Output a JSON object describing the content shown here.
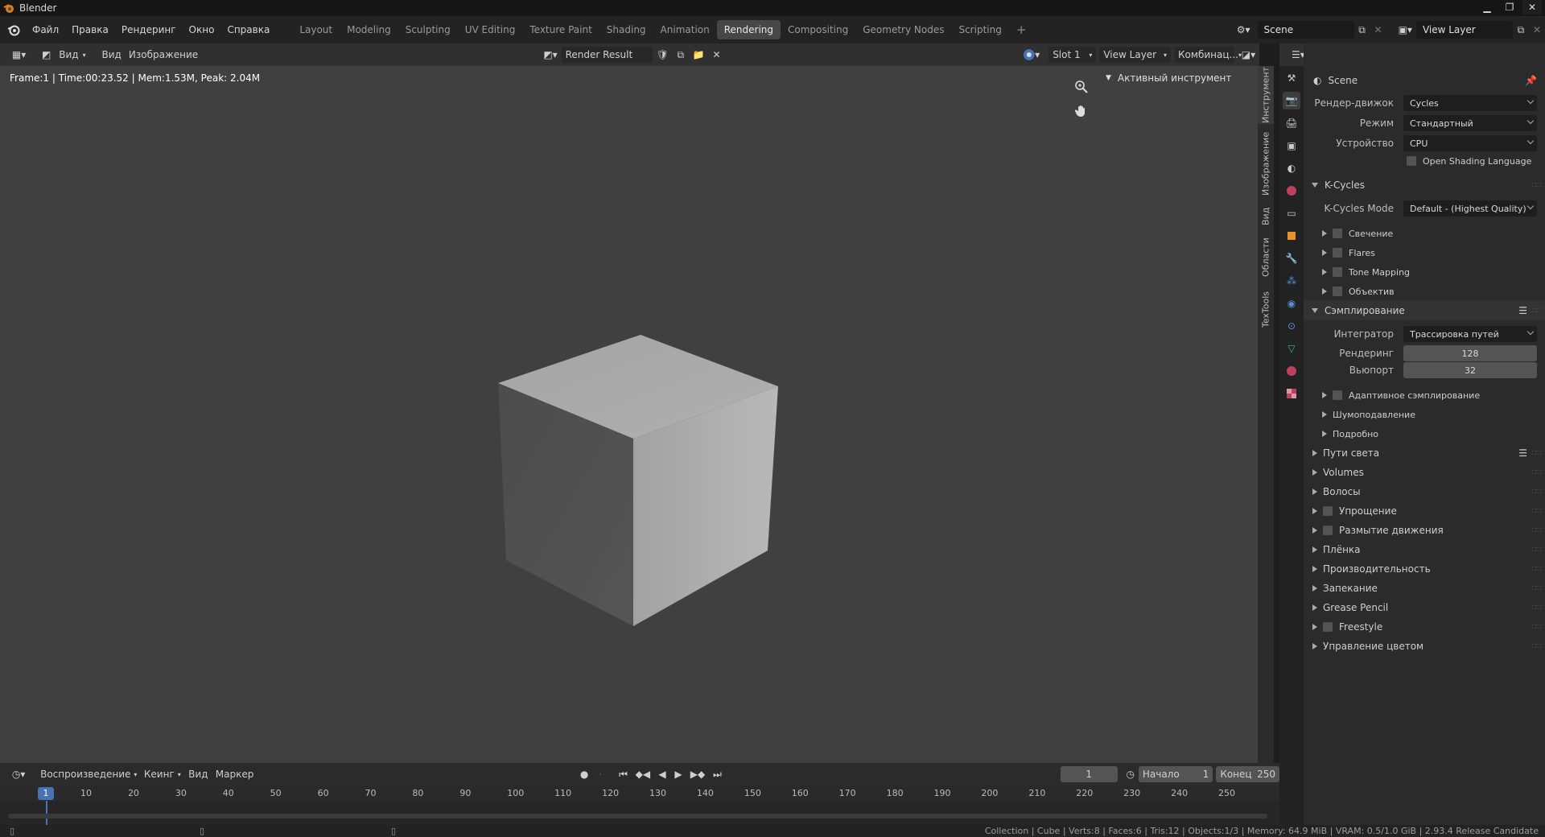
{
  "window": {
    "title": "Blender"
  },
  "menu": [
    "Файл",
    "Правка",
    "Рендеринг",
    "Окно",
    "Справка"
  ],
  "workspaces": [
    "Layout",
    "Modeling",
    "Sculpting",
    "UV Editing",
    "Texture Paint",
    "Shading",
    "Animation",
    "Rendering",
    "Compositing",
    "Geometry Nodes",
    "Scripting"
  ],
  "active_workspace": "Rendering",
  "scene": {
    "name": "Scene",
    "view_layer": "View Layer"
  },
  "image_header": {
    "view": "Вид",
    "view2": "Вид",
    "image": "Изображение",
    "image_name": "Render Result",
    "slot": "Slot 1",
    "view_layer": "View Layer",
    "pass": "Комбинац..."
  },
  "render_info": "Frame:1 | Time:00:23.52 | Mem:1.53M, Peak: 2.04M",
  "tool_panel": {
    "active_tool": "Активный инструмент"
  },
  "side_tabs": [
    "Инструмент",
    "Изображение",
    "Вид",
    "Области",
    "TexTools"
  ],
  "properties": {
    "context": "Scene",
    "render_engine_label": "Рендер-движок",
    "render_engine": "Cycles",
    "mode_label": "Режим",
    "mode": "Стандартный",
    "device_label": "Устройство",
    "device": "CPU",
    "osl": "Open Shading Language",
    "kcycles": {
      "title": "K-Cycles",
      "mode_label": "K-Cycles Mode",
      "mode": "Default - (Highest Quality)",
      "items": [
        "Свечение",
        "Flares",
        "Tone Mapping",
        "Объектив"
      ]
    },
    "sampling": {
      "title": "Сэмплирование",
      "integrator_label": "Интегратор",
      "integrator": "Трассировка путей",
      "render_label": "Рендеринг",
      "render": "128",
      "viewport_label": "Вьюпорт",
      "viewport": "32",
      "subs": [
        "Адаптивное сэмплирование",
        "Шумоподавление",
        "Подробно"
      ]
    },
    "sections": [
      {
        "label": "Пути света",
        "checkbox": false
      },
      {
        "label": "Volumes",
        "checkbox": false
      },
      {
        "label": "Волосы",
        "checkbox": false
      },
      {
        "label": "Упрощение",
        "checkbox": true
      },
      {
        "label": "Размытие движения",
        "checkbox": true
      },
      {
        "label": "Плёнка",
        "checkbox": false
      },
      {
        "label": "Производительность",
        "checkbox": false
      },
      {
        "label": "Запекание",
        "checkbox": false
      },
      {
        "label": "Grease Pencil",
        "checkbox": false
      },
      {
        "label": "Freestyle",
        "checkbox": true
      },
      {
        "label": "Управление цветом",
        "checkbox": false
      }
    ]
  },
  "timeline": {
    "playback": "Воспроизведение",
    "keying": "Кеинг",
    "view": "Вид",
    "marker": "Маркер",
    "current_frame": "1",
    "start_label": "Начало",
    "start": "1",
    "end_label": "Конец",
    "end": "250",
    "ticks": [
      "1",
      "10",
      "20",
      "30",
      "40",
      "50",
      "60",
      "70",
      "80",
      "90",
      "100",
      "110",
      "120",
      "130",
      "140",
      "150",
      "160",
      "170",
      "180",
      "190",
      "200",
      "210",
      "220",
      "230",
      "240",
      "250"
    ]
  },
  "statusbar": "Collection | Cube | Verts:8 | Faces:6 | Tris:12 | Objects:1/3 | Memory: 64.9 MiB | VRAM: 0.5/1.0 GiB | 2.93.4 Release Candidate",
  "colors": {
    "accent": "#4772b3",
    "blender_orange": "#e87d0d"
  }
}
